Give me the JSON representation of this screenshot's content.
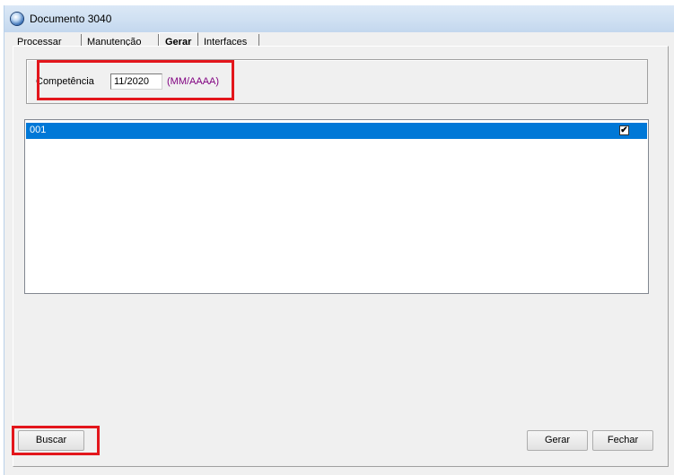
{
  "window": {
    "title": "Documento 3040"
  },
  "tabs": [
    {
      "label": "Processar"
    },
    {
      "label": "Manutenção"
    },
    {
      "label": "Gerar"
    },
    {
      "label": "Interfaces"
    }
  ],
  "active_tab": "Gerar",
  "competencia": {
    "label": "Competência",
    "value": "11/2020",
    "hint": "(MM/AAAA)"
  },
  "list": {
    "rows": [
      {
        "label": "001",
        "checked": true,
        "selected": true
      }
    ]
  },
  "buttons": {
    "buscar": "Buscar",
    "gerar": "Gerar",
    "fechar": "Fechar"
  },
  "colors": {
    "highlight": "#e3161c",
    "selection": "#0078d7",
    "hint": "#800080"
  }
}
